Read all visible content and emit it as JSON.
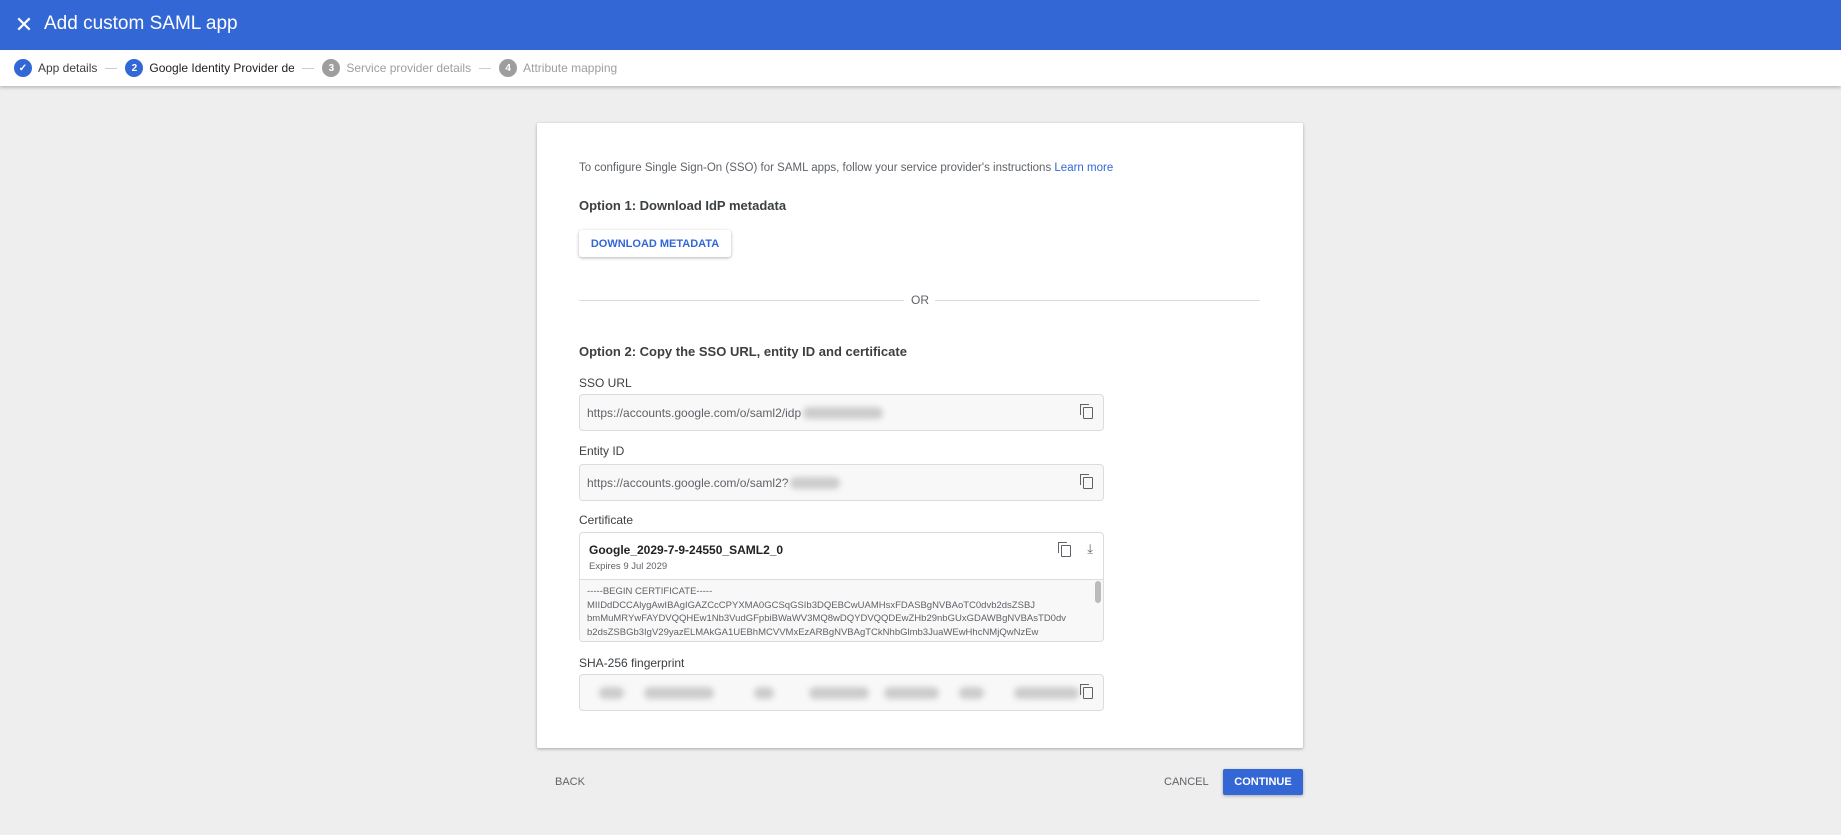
{
  "header": {
    "title": "Add custom SAML app",
    "close_icon": "close-icon",
    "color": "#3367d6"
  },
  "stepper": {
    "steps": [
      {
        "label": "App details",
        "state": "done",
        "marker": "check"
      },
      {
        "label": "Google Identity Provider details",
        "state": "active",
        "marker": "2"
      },
      {
        "label": "Service provider details",
        "state": "pending",
        "marker": "3"
      },
      {
        "label": "Attribute mapping",
        "state": "pending",
        "marker": "4"
      }
    ]
  },
  "card": {
    "intro": "To configure Single Sign-On (SSO) for SAML apps, follow your service provider's instructions",
    "learn_more": "Learn more",
    "option1": "Option 1: Download IdP metadata",
    "download_button": "DOWNLOAD METADATA",
    "or": "OR",
    "option2": "Option 2: Copy the SSO URL, entity ID and certificate",
    "sso_url": {
      "label": "SSO URL",
      "value": "https://accounts.google.com/o/saml2/idp"
    },
    "entity_id": {
      "label": "Entity ID",
      "value": "https://accounts.google.com/o/saml2?"
    },
    "certificate": {
      "label": "Certificate",
      "name": "Google_2029-7-9-24550_SAML2_0",
      "expires": "Expires 9 Jul 2029",
      "lines": [
        "-----BEGIN CERTIFICATE-----",
        "MIIDdDCCAlygAwIBAgIGAZCcCPYXMA0GCSqGSIb3DQEBCwUAMHsxFDASBgNVBAoTC0dvb2dsZSBJ",
        "bmMuMRYwFAYDVQQHEw1Nb3VudGFpbiBWaWV3MQ8wDQYDVQQDEwZHb29nbGUxGDAWBgNVBAsTD0dv",
        "b2dsZSBGb3IgV29yazELMAkGA1UEBhMCVVMxEzARBgNVBAgTCkNhbGlmb3JuaWEwHhcNMjQwNzEw"
      ]
    },
    "fingerprint": {
      "label": "SHA-256 fingerprint"
    }
  },
  "footer": {
    "back": "BACK",
    "cancel": "CANCEL",
    "continue": "CONTINUE"
  }
}
